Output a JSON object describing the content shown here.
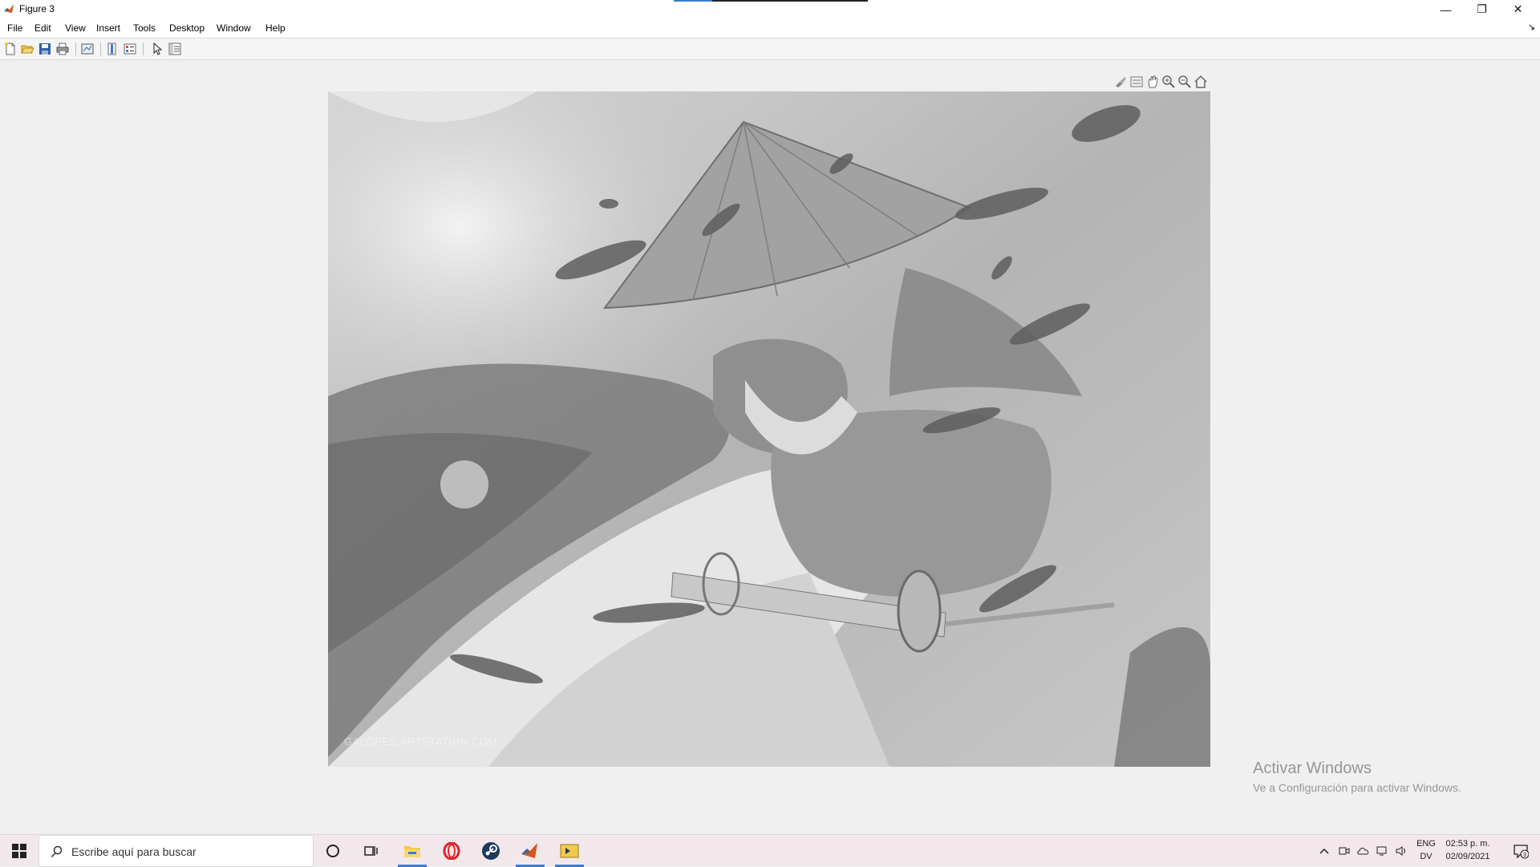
{
  "window": {
    "title": "Figure 3",
    "controls": {
      "minimize": "—",
      "restore": "❐",
      "close": "✕"
    }
  },
  "menu": {
    "items": [
      "File",
      "Edit",
      "View",
      "Insert",
      "Tools",
      "Desktop",
      "Window",
      "Help"
    ],
    "dock_arrow": "↘"
  },
  "toolbar": {
    "buttons": [
      "new-figure-icon",
      "open-file-icon",
      "save-icon",
      "print-icon",
      "link-plot-icon",
      "insert-colorbar-icon",
      "insert-legend-icon",
      "edit-plot-icon",
      "open-property-inspector-icon"
    ]
  },
  "axes_toolbar": {
    "buttons": [
      "brush-icon",
      "datatips-icon",
      "pan-icon",
      "zoom-in-icon",
      "zoom-out-icon",
      "restore-view-icon"
    ]
  },
  "image": {
    "description_icon": "grayscale-image",
    "watermark": "GALOPES.ARTSTATION.COM"
  },
  "activation": {
    "title": "Activar Windows",
    "subtitle": "Ve a Configuración para activar Windows."
  },
  "taskbar": {
    "search_placeholder": "Escribe aquí para buscar",
    "apps": [
      "cortana-icon",
      "task-view-icon",
      "file-explorer-icon",
      "opera-icon",
      "steam-icon",
      "matlab-icon",
      "app-icon"
    ],
    "language_line1": "ENG",
    "language_line2": "DV",
    "time": "02:53 p. m.",
    "date": "02/09/2021",
    "notification_count": "3"
  },
  "colors": {
    "accent": "#3d7bd1",
    "taskbar_bg": "#f2e8ec",
    "figure_bg": "#f0f0f0"
  }
}
